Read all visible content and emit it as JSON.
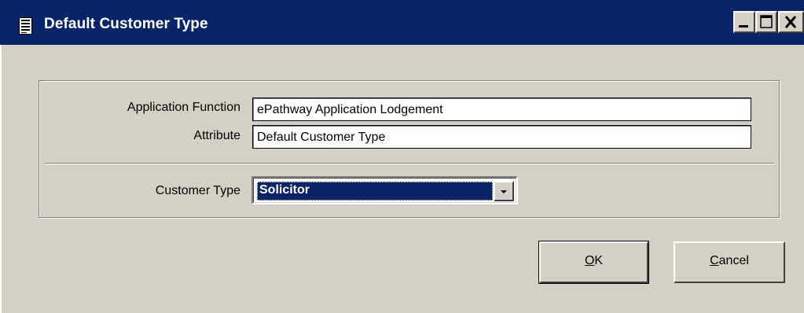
{
  "window": {
    "title": "Default Customer Type",
    "icon": "document-icon"
  },
  "titlebar_buttons": {
    "minimize_icon": "minimize-icon",
    "maximize_icon": "maximize-icon",
    "close_icon": "close-icon"
  },
  "form": {
    "application_function_label": "Application Function",
    "application_function_value": "ePathway Application Lodgement",
    "attribute_label": "Attribute",
    "attribute_value": "Default Customer Type",
    "customer_type_label": "Customer Type",
    "customer_type_value": "Solicitor"
  },
  "buttons": {
    "ok_mnemonic": "O",
    "ok_rest": "K",
    "cancel_mnemonic": "C",
    "cancel_rest": "ancel"
  },
  "colors": {
    "titlebar": "#0a246a",
    "face": "#d4d0c8",
    "selection": "#0a246a"
  }
}
